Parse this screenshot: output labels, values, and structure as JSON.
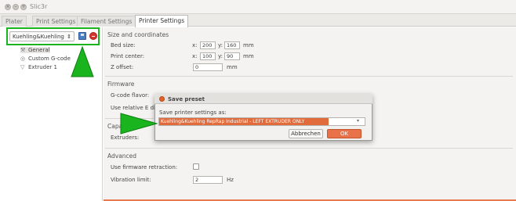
{
  "window": {
    "title": "Slic3r"
  },
  "tabs": [
    {
      "label": "Plater"
    },
    {
      "label": "Print Settings"
    },
    {
      "label": "Filament Settings"
    },
    {
      "label": "Printer Settings"
    }
  ],
  "sidebar": {
    "preset": "Kuehling&Kuehling",
    "items": [
      {
        "label": "General",
        "icon": "wrench-icon"
      },
      {
        "label": "Custom G-code",
        "icon": "gcode-icon"
      },
      {
        "label": "Extruder 1",
        "icon": "extruder-icon"
      }
    ]
  },
  "settings": {
    "size_section": "Size and coordinates",
    "bed_size_label": "Bed size:",
    "bed_x_label": "x:",
    "bed_x": "200",
    "bed_y_label": "y:",
    "bed_y": "160",
    "bed_unit": "mm",
    "print_center_label": "Print center:",
    "center_x_label": "x:",
    "center_x": "100",
    "center_y_label": "y:",
    "center_y": "90",
    "center_unit": "mm",
    "z_offset_label": "Z offset:",
    "z_offset": "0",
    "z_offset_unit": "mm",
    "firmware_section": "Firmware",
    "gcode_flavor_label": "G-code flavor:",
    "relative_e_label": "Use relative E di",
    "capabilities_section": "Capa",
    "extruders_label": "Extruders:",
    "advanced_section": "Advanced",
    "fw_retraction_label": "Use firmware retraction:",
    "vibration_label": "Vibration limit:",
    "vibration_value": "2",
    "vibration_unit": "Hz"
  },
  "dialog": {
    "title": "Save preset",
    "prompt": "Save printer settings as:",
    "value": "Kuehling&Kuehling RepRap Industrial - LEFT EXTRUDER ONLY",
    "cancel": "Abbrechen",
    "ok": "OK"
  },
  "colors": {
    "accent": "#e26b3c",
    "highlight": "#1ab51e"
  }
}
